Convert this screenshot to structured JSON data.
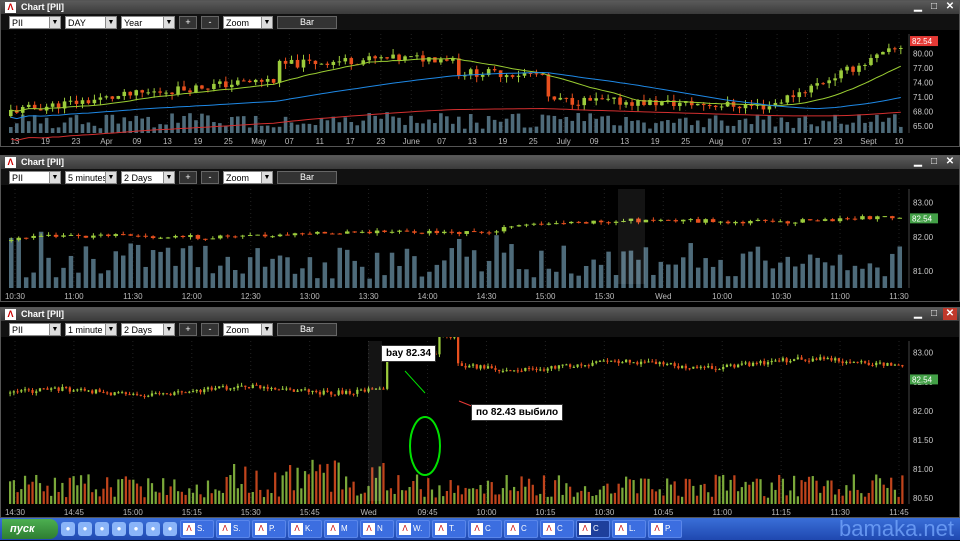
{
  "panels": [
    {
      "title": "Chart [PII]",
      "symbol": "PII",
      "interval": "DAY",
      "period": "Year",
      "zoom": "Zoom",
      "plus": "+",
      "minus": "-",
      "mode": "Bar",
      "last_price": "82.54",
      "price_color": "#e53935",
      "y_ticks": [
        "80.00",
        "77.00",
        "74.00",
        "71.00",
        "68.00",
        "65.00"
      ],
      "y_tick_values": [
        80,
        77,
        74,
        71,
        68,
        65
      ],
      "y_range": [
        63.5,
        84
      ],
      "x_labels": [
        "13",
        "19",
        "23",
        "Apr",
        "09",
        "13",
        "19",
        "25",
        "May",
        "07",
        "11",
        "17",
        "23",
        "June",
        "07",
        "13",
        "19",
        "25",
        "July",
        "09",
        "13",
        "19",
        "25",
        "Aug",
        "07",
        "13",
        "17",
        "23",
        "Sept",
        "10"
      ]
    },
    {
      "title": "Chart [PII]",
      "symbol": "PII",
      "interval": "5 minutes",
      "period": "2 Days",
      "zoom": "Zoom",
      "plus": "+",
      "minus": "-",
      "mode": "Bar",
      "last_price": "82.54",
      "price_color": "#43a047",
      "y_ticks": [
        "83.00",
        "82.00",
        "81.00"
      ],
      "y_tick_values": [
        83,
        82,
        81
      ],
      "y_range": [
        80.5,
        83.4
      ],
      "x_labels": [
        "10:30",
        "11:00",
        "11:30",
        "12:00",
        "12:30",
        "13:00",
        "13:30",
        "14:00",
        "14:30",
        "15:00",
        "15:30",
        "Wed",
        "10:00",
        "10:30",
        "11:00",
        "11:30"
      ]
    },
    {
      "title": "Chart [PII]",
      "symbol": "PII",
      "interval": "1 minute",
      "period": "2 Days",
      "zoom": "Zoom",
      "plus": "+",
      "minus": "-",
      "mode": "Bar",
      "last_price": "82.54",
      "price_color": "#43a047",
      "y_ticks": [
        "83.00",
        "82.50",
        "82.00",
        "81.50",
        "81.00",
        "80.50"
      ],
      "y_tick_values": [
        83,
        82.5,
        82,
        81.5,
        81,
        80.5
      ],
      "y_range": [
        80.4,
        83.2
      ],
      "x_labels": [
        "14:30",
        "14:45",
        "15:00",
        "15:15",
        "15:30",
        "15:45",
        "Wed",
        "09:45",
        "10:00",
        "10:15",
        "10:30",
        "10:45",
        "11:00",
        "11:15",
        "11:30",
        "11:45"
      ],
      "annotations": {
        "buy": "bay 82.34",
        "stop": "по 82.43 выбило"
      }
    }
  ],
  "taskbar": {
    "start": "пуск",
    "tasks": [
      "S.",
      "S.",
      "P.",
      "K.",
      "M",
      "N",
      "W.",
      "T.",
      "C",
      "C",
      "C",
      "C",
      "L.",
      "P."
    ]
  },
  "watermark": "bamaka.net",
  "colors": {
    "up": "#9ccc3c",
    "down": "#e8501e",
    "volume": "#4e6b7a",
    "ma_short": "#9acd32",
    "ma_long": "#1e88e5",
    "ma_red": "#d32f2f"
  }
}
